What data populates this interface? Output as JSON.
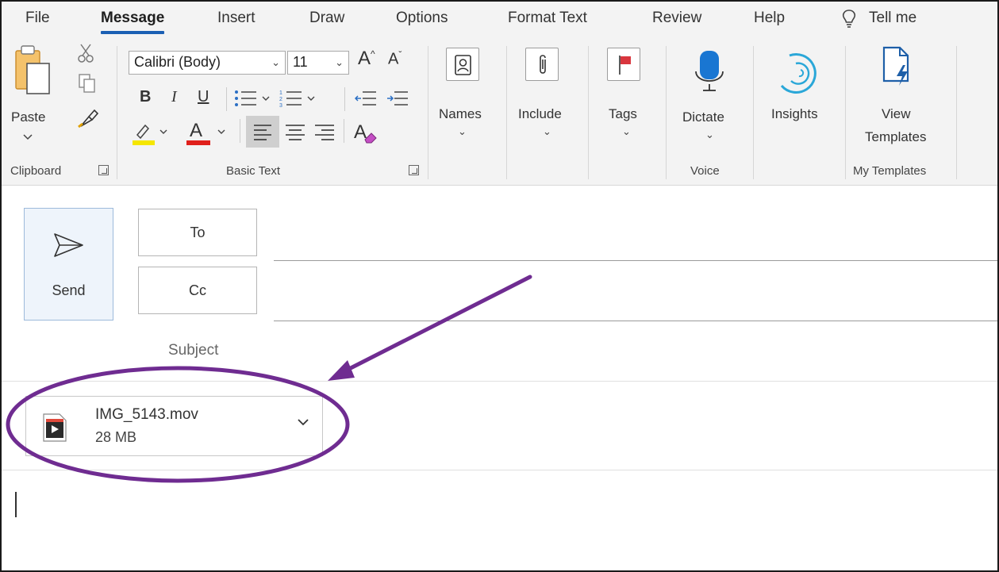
{
  "menu": {
    "tabs": [
      "File",
      "Message",
      "Insert",
      "Draw",
      "Options",
      "Format Text",
      "Review",
      "Help"
    ],
    "active_tab": "Message",
    "tell_me": "Tell me"
  },
  "ribbon": {
    "clipboard": {
      "paste_label": "Paste",
      "group_label": "Clipboard"
    },
    "basic_text": {
      "font_name": "Calibri (Body)",
      "font_size": "11",
      "group_label": "Basic Text"
    },
    "names_label": "Names",
    "include_label": "Include",
    "tags_label": "Tags",
    "dictate_label": "Dictate",
    "voice_group_label": "Voice",
    "insights_label": "Insights",
    "view_templates_line1": "View",
    "view_templates_line2": "Templates",
    "my_templates_group_label": "My Templates",
    "colors": {
      "highlight": "#f5e600",
      "font_color": "#e0201b",
      "insights": "#2aa7d8",
      "dictate": "#1976d2",
      "tags_flag": "#d9363e"
    }
  },
  "compose": {
    "send_label": "Send",
    "to_label": "To",
    "cc_label": "Cc",
    "subject_label": "Subject"
  },
  "attachment": {
    "file_name": "IMG_5143.mov",
    "file_size": "28 MB",
    "icon": "video-file-icon"
  },
  "annotation": {
    "color": "#6f2c91"
  }
}
